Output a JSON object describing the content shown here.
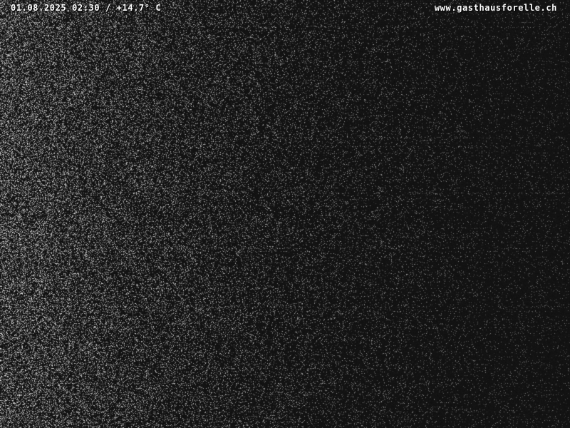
{
  "overlay": {
    "timestamp_temperature": "01.08.2025 02:30 / +14.7° C",
    "website": "www.gasthausforelle.ch"
  },
  "colors": {
    "background": "#111111",
    "text": "#ffffff"
  }
}
